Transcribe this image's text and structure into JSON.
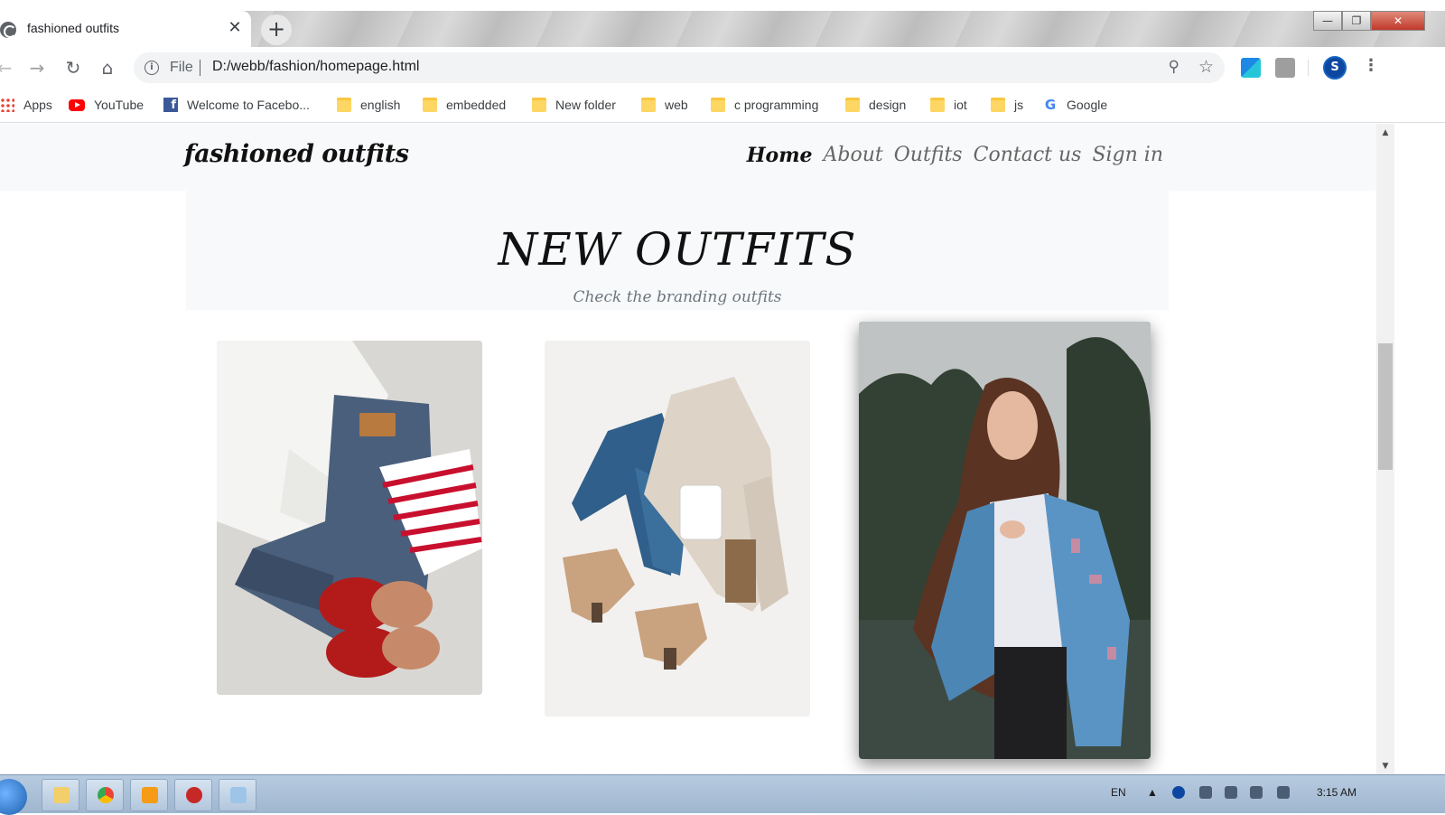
{
  "browser": {
    "tab": {
      "title": "fashioned outfits",
      "close": "✕"
    },
    "new_tab": "+",
    "window_buttons": {
      "minimize": "—",
      "maximize": "❐",
      "close": "✕"
    },
    "nav": {
      "back": "←",
      "forward": "→",
      "reload": "↻",
      "home": "⌂"
    },
    "omnibox": {
      "info": "i",
      "scheme": "File",
      "url": "D:/webb/fashion/homepage.html",
      "zoom_icon": "⚲",
      "star_icon": "☆"
    },
    "profile_initial": "S",
    "menu": "⋮"
  },
  "bookmarks": [
    {
      "label": "Apps",
      "icon": "apps-icon"
    },
    {
      "label": "YouTube",
      "icon": "youtube-icon"
    },
    {
      "label": "Welcome to Facebo...",
      "icon": "facebook-icon"
    },
    {
      "label": "english",
      "icon": "folder-icon"
    },
    {
      "label": "embedded",
      "icon": "folder-icon"
    },
    {
      "label": "New folder",
      "icon": "folder-icon"
    },
    {
      "label": "web",
      "icon": "folder-icon"
    },
    {
      "label": "c programming",
      "icon": "folder-icon"
    },
    {
      "label": "design",
      "icon": "folder-icon"
    },
    {
      "label": "iot",
      "icon": "folder-icon"
    },
    {
      "label": "js",
      "icon": "folder-icon"
    },
    {
      "label": "Google",
      "icon": "google-icon"
    }
  ],
  "site": {
    "brand": "fashioned outfits",
    "nav": [
      "Home",
      "About",
      "Outfits",
      "Contact us",
      "Sign in"
    ],
    "active_nav": "Home",
    "hero": {
      "title": "NEW OUTFITS",
      "subtitle": "Check the branding outfits"
    },
    "cards": [
      {
        "icon": "outfit-flatlay-photo"
      },
      {
        "icon": "outfit-jeans-sweater-photo"
      },
      {
        "icon": "woman-denim-jacket-photo"
      }
    ]
  },
  "taskbar": {
    "language": "EN",
    "time": "3:15 AM"
  },
  "colors": {
    "header_bg": "#f8f9fa",
    "text_dark": "#111111",
    "text_muted": "#666666",
    "scroll_thumb": "#c1c1c1"
  }
}
